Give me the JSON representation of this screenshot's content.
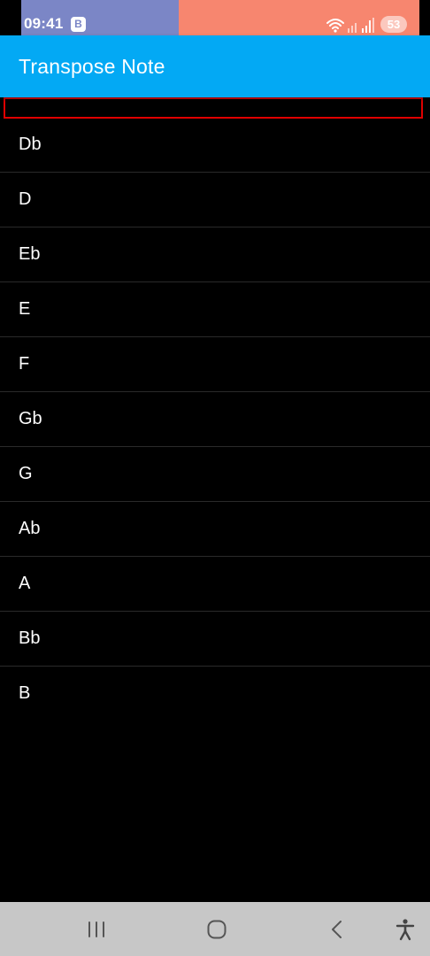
{
  "status_bar": {
    "time": "09:41",
    "app_badge": "B",
    "battery": "53",
    "icons": [
      "wifi-icon",
      "signal-icon",
      "signal-icon"
    ],
    "colors": {
      "left_bg": "#7b86c6",
      "right_bg": "#f7866f"
    }
  },
  "app_bar": {
    "title": "Transpose Note",
    "color": "#03a9f4"
  },
  "highlight_row": {
    "label": "",
    "border_color": "#e00000"
  },
  "notes": [
    {
      "label": "Db"
    },
    {
      "label": "D"
    },
    {
      "label": "Eb"
    },
    {
      "label": "E"
    },
    {
      "label": "F"
    },
    {
      "label": "Gb"
    },
    {
      "label": "G"
    },
    {
      "label": "Ab"
    },
    {
      "label": "A"
    },
    {
      "label": "Bb"
    },
    {
      "label": "B"
    }
  ],
  "nav_bar": {
    "buttons": [
      "recent-apps-icon",
      "home-icon",
      "back-icon",
      "accessibility-icon"
    ]
  }
}
